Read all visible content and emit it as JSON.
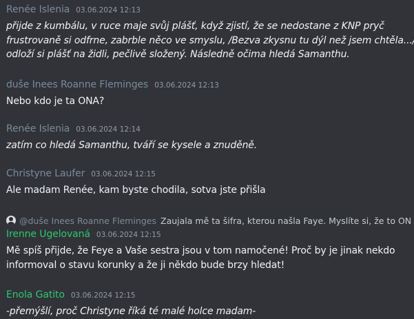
{
  "colors": {
    "background": "#313338",
    "author_default": "#7a8b9c",
    "author_green": "#2dc770",
    "timestamp": "#949ba4",
    "text": "#f2f3f5"
  },
  "messages": [
    {
      "author": "Renée Islenia",
      "time": "03.06.2024 12:13",
      "lines": [
        "přijde z kumbálu, v ruce maje svůj plášť, když zjistí, že se nedostane z KNP pryč",
        "frustrovaně si odfrne, zabrble něco ve smyslu, /Bezva zkysnu tu dýl než jsem chtěla.../",
        "odloží si plášť na židli, pečlivě složený. Následně očima hledá Samanthu."
      ]
    },
    {
      "author": "duše Inees Roanne Fleminges",
      "time": "03.06.2024 12:13",
      "lines": [
        "Nebo kdo je ta ONA?"
      ]
    },
    {
      "author": "Renée Islenia",
      "time": "03.06.2024 12:14",
      "lines": [
        "zatím co hledá Samanthu, tváří se kysele a znuděně."
      ]
    },
    {
      "author": "Christyne Laufer",
      "time": "03.06.2024 12:15",
      "lines": [
        "Ale madam Renée, kam byste chodila, sotva jste přišla"
      ]
    },
    {
      "reply": {
        "author": "@duše Inees Roanne Fleminges",
        "snippet": "Zaujala mě ta šifra, kterou našla Faye. Myslíte si, že to ONA zn..."
      },
      "author": "Irenne Ugelovaná",
      "time": "03.06.2024 12:15",
      "lines": [
        "Mě spíš přijde, že Feye a Vaše sestra jsou v tom namočené! Proč by je jinak nekdo",
        "informoval o stavu korunky a že ji někdo bude brzy hledat!"
      ]
    },
    {
      "author": "Enola Gatito",
      "time": "03.06.2024 12:15",
      "lines": [
        "-přemýšlí, proč Christyne říká té malé holce madam-"
      ]
    }
  ]
}
